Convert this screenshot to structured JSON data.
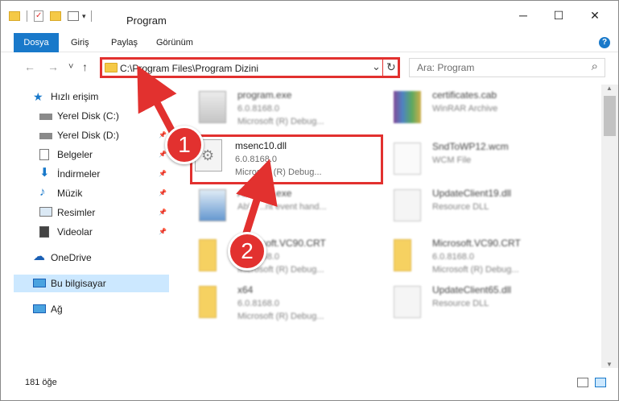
{
  "window": {
    "title": "Program",
    "minimize": "─",
    "maximize": "☐",
    "close": "✕"
  },
  "ribbon": {
    "tabs": [
      "Dosya",
      "Giriş",
      "Paylaş",
      "Görünüm"
    ],
    "help": "?"
  },
  "nav": {
    "back": "←",
    "forward": "→",
    "recent": "˅",
    "up": "↑",
    "address": "C:\\Program Files\\Program Dizini",
    "dropdown": "⌄",
    "refresh": "↻",
    "search_placeholder": "Ara: Program",
    "search_icon": "⌕"
  },
  "sidebar": {
    "items": [
      {
        "label": "Hızlı erişim",
        "icon": "star-icon"
      },
      {
        "label": "Yerel Disk (C:)",
        "icon": "drive-icon",
        "pin": "📌"
      },
      {
        "label": "Yerel Disk (D:)",
        "icon": "drive-icon",
        "pin": "📌"
      },
      {
        "label": "Belgeler",
        "icon": "documents-icon",
        "pin": "📌"
      },
      {
        "label": "İndirmeler",
        "icon": "download-icon",
        "pin": "📌"
      },
      {
        "label": "Müzik",
        "icon": "music-icon",
        "pin": "📌"
      },
      {
        "label": "Resimler",
        "icon": "pictures-icon",
        "pin": "📌"
      },
      {
        "label": "Videolar",
        "icon": "videos-icon",
        "pin": "📌"
      },
      {
        "label": "OneDrive",
        "icon": "cloud-icon"
      },
      {
        "label": "Bu bilgisayar",
        "icon": "computer-icon"
      },
      {
        "label": "Ağ",
        "icon": "network-icon"
      }
    ]
  },
  "files": [
    {
      "name": "program.exe",
      "line2": "6.0.8168.0",
      "line3": "Microsoft (R) Debug..."
    },
    {
      "name": "certificates.cab",
      "line2": "WinRAR Archive",
      "line3": ""
    },
    {
      "name": "msenc10.dll",
      "line2": "6.0.8168.0",
      "line3": "Microsoft (R) Debug..."
    },
    {
      "name": "SndToWP12.wcm",
      "line2": "WCM File",
      "line3": ""
    },
    {
      "name": "Abhb...d.exe",
      "line2": "Abhb...nt event hand...",
      "line3": ""
    },
    {
      "name": "UpdateClient19.dll",
      "line2": "Resource DLL",
      "line3": ""
    },
    {
      "name": "Microsoft.VC90.CRT",
      "line2": "6.0.8168.0",
      "line3": "Microsoft (R) Debug..."
    },
    {
      "name": "Microsoft.VC90.CRT",
      "line2": "6.0.8168.0",
      "line3": "Microsoft (R) Debug..."
    },
    {
      "name": "x64",
      "line2": "6.0.8168.0",
      "line3": "Microsoft (R) Debug..."
    },
    {
      "name": "UpdateClient65.dll",
      "line2": "Resource DLL",
      "line3": ""
    }
  ],
  "status": {
    "count": "181 öğe"
  },
  "callouts": {
    "one": "1",
    "two": "2"
  },
  "colors": {
    "accent": "#1979ca",
    "highlight": "#e2312f",
    "selected": "#cce8ff"
  }
}
